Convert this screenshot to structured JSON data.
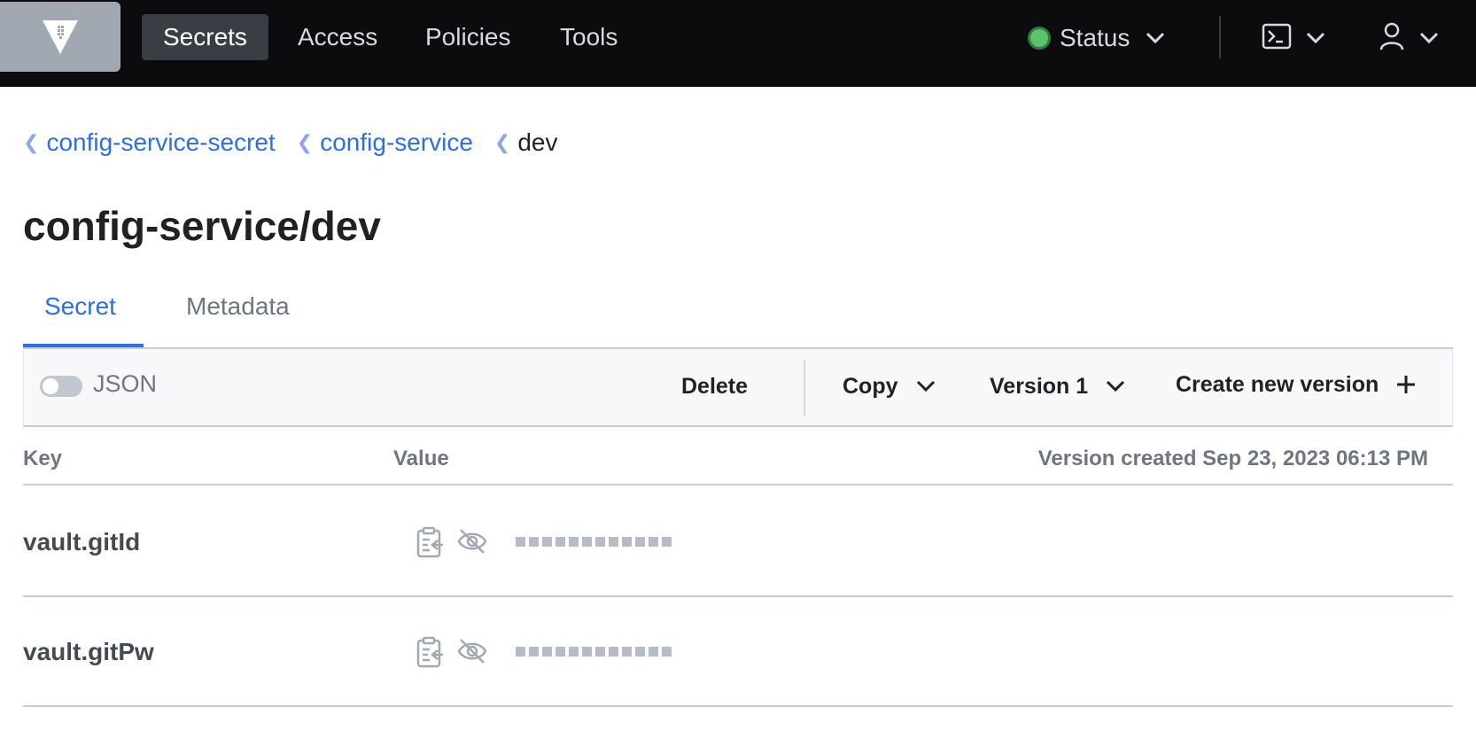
{
  "nav": {
    "items": [
      {
        "label": "Secrets",
        "active": true
      },
      {
        "label": "Access",
        "active": false
      },
      {
        "label": "Policies",
        "active": false
      },
      {
        "label": "Tools",
        "active": false
      }
    ],
    "status_label": "Status",
    "status_color": "#5dc26f",
    "logo_icon": "vault-logo-icon",
    "console_icon": "terminal-icon",
    "user_icon": "user-icon"
  },
  "breadcrumb": {
    "links": [
      "config-service-secret",
      "config-service"
    ],
    "current": "dev"
  },
  "page": {
    "title": "config-service/dev"
  },
  "tabs": [
    {
      "label": "Secret",
      "active": true
    },
    {
      "label": "Metadata",
      "active": false
    }
  ],
  "toolbar": {
    "json_toggle_label": "JSON",
    "json_toggle_on": false,
    "delete_label": "Delete",
    "copy_label": "Copy",
    "version_label": "Version 1",
    "create_label": "Create new version"
  },
  "table": {
    "headers": {
      "key": "Key",
      "value": "Value",
      "version_created": "Version created Sep 23, 2023 06:13 PM"
    },
    "rows": [
      {
        "key": "vault.gitId",
        "masked": true
      },
      {
        "key": "vault.gitPw",
        "masked": true
      }
    ]
  },
  "colors": {
    "accent": "#2e6ee0",
    "nav_bg": "#0c0c0e",
    "nav_active_bg": "#3b3d45"
  }
}
